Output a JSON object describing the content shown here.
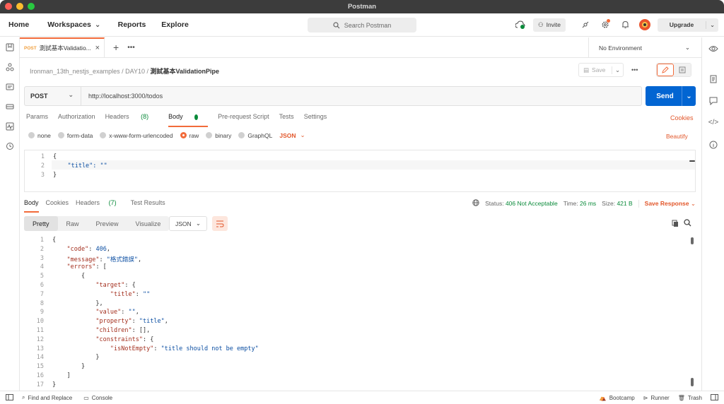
{
  "window": {
    "title": "Postman"
  },
  "appbar": {
    "home": "Home",
    "workspaces": "Workspaces",
    "reports": "Reports",
    "explore": "Explore",
    "search_placeholder": "Search Postman",
    "invite": "Invite",
    "upgrade": "Upgrade"
  },
  "tab": {
    "method": "POST",
    "name": "測試基本Validatio..."
  },
  "environment": "No Environment",
  "breadcrumb": {
    "collection": "Ironman_13th_nestjs_examples",
    "folder": "DAY10",
    "request": "測試基本ValidationPipe",
    "save": "Save"
  },
  "request": {
    "method": "POST",
    "url": "http://localhost:3000/todos",
    "send": "Send"
  },
  "request_tabs": [
    "Params",
    "Authorization",
    "Headers",
    "(8)",
    "Body",
    "Pre-request Script",
    "Tests",
    "Settings"
  ],
  "cookies": "Cookies",
  "body_types": [
    "none",
    "form-data",
    "x-www-form-urlencoded",
    "raw",
    "binary",
    "GraphQL"
  ],
  "body_format": "JSON",
  "beautify": "Beautify",
  "request_body_lines": [
    "{",
    "    \"title\": \"\"",
    "}"
  ],
  "response_tabs": {
    "body": "Body",
    "cookies": "Cookies",
    "headers": "Headers",
    "headers_count": "(7)",
    "tests": "Test Results"
  },
  "response_status": {
    "status_label": "Status:",
    "status": "406 Not Acceptable",
    "time_label": "Time:",
    "time": "26 ms",
    "size_label": "Size:",
    "size": "421 B",
    "save": "Save Response"
  },
  "view_modes": [
    "Pretty",
    "Raw",
    "Preview",
    "Visualize"
  ],
  "response_format": "JSON",
  "response_lines": [
    "{",
    "    \"code\": 406,",
    "    \"message\": \"格式錯誤\",",
    "    \"errors\": [",
    "        {",
    "            \"target\": {",
    "                \"title\": \"\"",
    "            },",
    "            \"value\": \"\",",
    "            \"property\": \"title\",",
    "            \"children\": [],",
    "            \"constraints\": {",
    "                \"isNotEmpty\": \"title should not be empty\"",
    "            }",
    "        }",
    "    ]",
    "}"
  ],
  "statusbar": {
    "find": "Find and Replace",
    "console": "Console",
    "bootcamp": "Bootcamp",
    "runner": "Runner",
    "trash": "Trash"
  }
}
